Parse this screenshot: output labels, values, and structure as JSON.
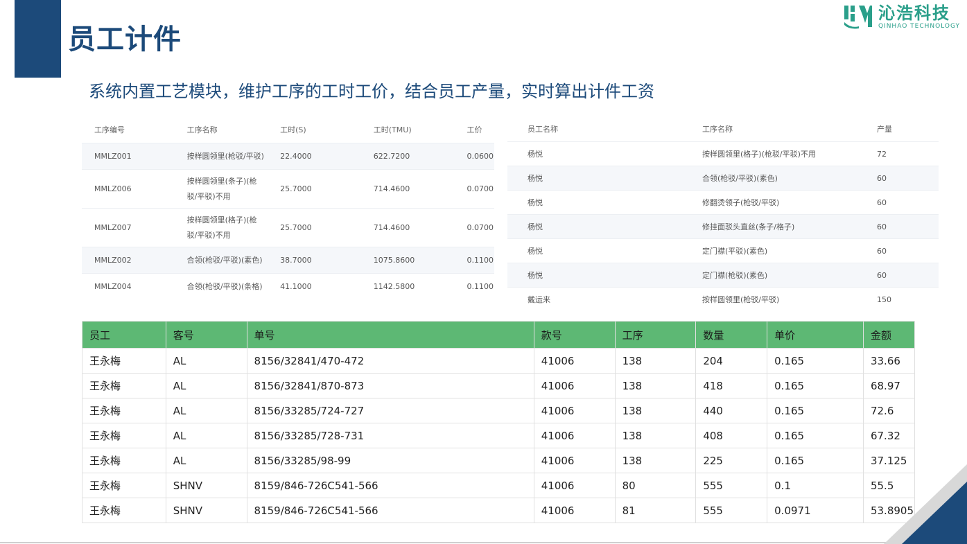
{
  "header": {
    "title": "员工计件",
    "subtitle": "系统内置工艺模块，维护工序的工时工价，结合员工产量，实时算出计件工资"
  },
  "logo": {
    "cn": "沁浩科技",
    "en": "QINHAO TECHNOLOGY",
    "color": "#2a9f8a"
  },
  "process_table": {
    "headers": [
      "工序编号",
      "工序名称",
      "工时(S)",
      "工时(TMU)",
      "工价"
    ],
    "rows": [
      [
        "MMLZ001",
        "按样圆领里(枪驳/平驳)",
        "22.4000",
        "622.7200",
        "0.0600"
      ],
      [
        "MMLZ006",
        "按样圆领里(条子)(枪驳/平驳)不用",
        "25.7000",
        "714.4600",
        "0.0700"
      ],
      [
        "MMLZ007",
        "按样圆领里(格子)(枪驳/平驳)不用",
        "25.7000",
        "714.4600",
        "0.0700"
      ],
      [
        "MMLZ002",
        "合领(枪驳/平驳)(素色)",
        "38.7000",
        "1075.8600",
        "0.1100"
      ],
      [
        "MMLZ004",
        "合领(枪驳/平驳)(条格)",
        "41.1000",
        "1142.5800",
        "0.1100"
      ]
    ]
  },
  "employee_table": {
    "headers": [
      "员工名称",
      "工序名称",
      "产量"
    ],
    "rows": [
      [
        "杨悦",
        "按样圆领里(格子)(枪驳/平驳)不用",
        "72"
      ],
      [
        "杨悦",
        "合领(枪驳/平驳)(素色)",
        "60"
      ],
      [
        "杨悦",
        "修翻烫领子(枪驳/平驳)",
        "60"
      ],
      [
        "杨悦",
        "修挂面驳头直丝(条子/格子)",
        "60"
      ],
      [
        "杨悦",
        "定门襟(平驳)(素色)",
        "60"
      ],
      [
        "杨悦",
        "定门襟(枪驳)(素色)",
        "60"
      ],
      [
        "戴运来",
        "按样圆领里(枪驳/平驳)",
        "150"
      ]
    ]
  },
  "wage_table": {
    "header_color": "#5db874",
    "headers": [
      "员工",
      "客号",
      "单号",
      "款号",
      "工序",
      "数量",
      "单价",
      "金额"
    ],
    "rows": [
      [
        "王永梅",
        "AL",
        "8156/32841/470-472",
        "41006",
        "138",
        "204",
        "0.165",
        "33.66"
      ],
      [
        "王永梅",
        "AL",
        "8156/32841/870-873",
        "41006",
        "138",
        "418",
        "0.165",
        "68.97"
      ],
      [
        "王永梅",
        "AL",
        "8156/33285/724-727",
        "41006",
        "138",
        "440",
        "0.165",
        "72.6"
      ],
      [
        "王永梅",
        "AL",
        "8156/33285/728-731",
        "41006",
        "138",
        "408",
        "0.165",
        "67.32"
      ],
      [
        "王永梅",
        "AL",
        "8156/33285/98-99",
        "41006",
        "138",
        "225",
        "0.165",
        "37.125"
      ],
      [
        "王永梅",
        "SHNV",
        "8159/846-726C541-566",
        "41006",
        "80",
        "555",
        "0.1",
        "55.5"
      ],
      [
        "王永梅",
        "SHNV",
        "8159/846-726C541-566",
        "41006",
        "81",
        "555",
        "0.0971",
        "53.8905"
      ]
    ]
  },
  "colors": {
    "brand_blue": "#1c4a7a",
    "teal": "#2a9f8a",
    "green": "#5db874"
  }
}
